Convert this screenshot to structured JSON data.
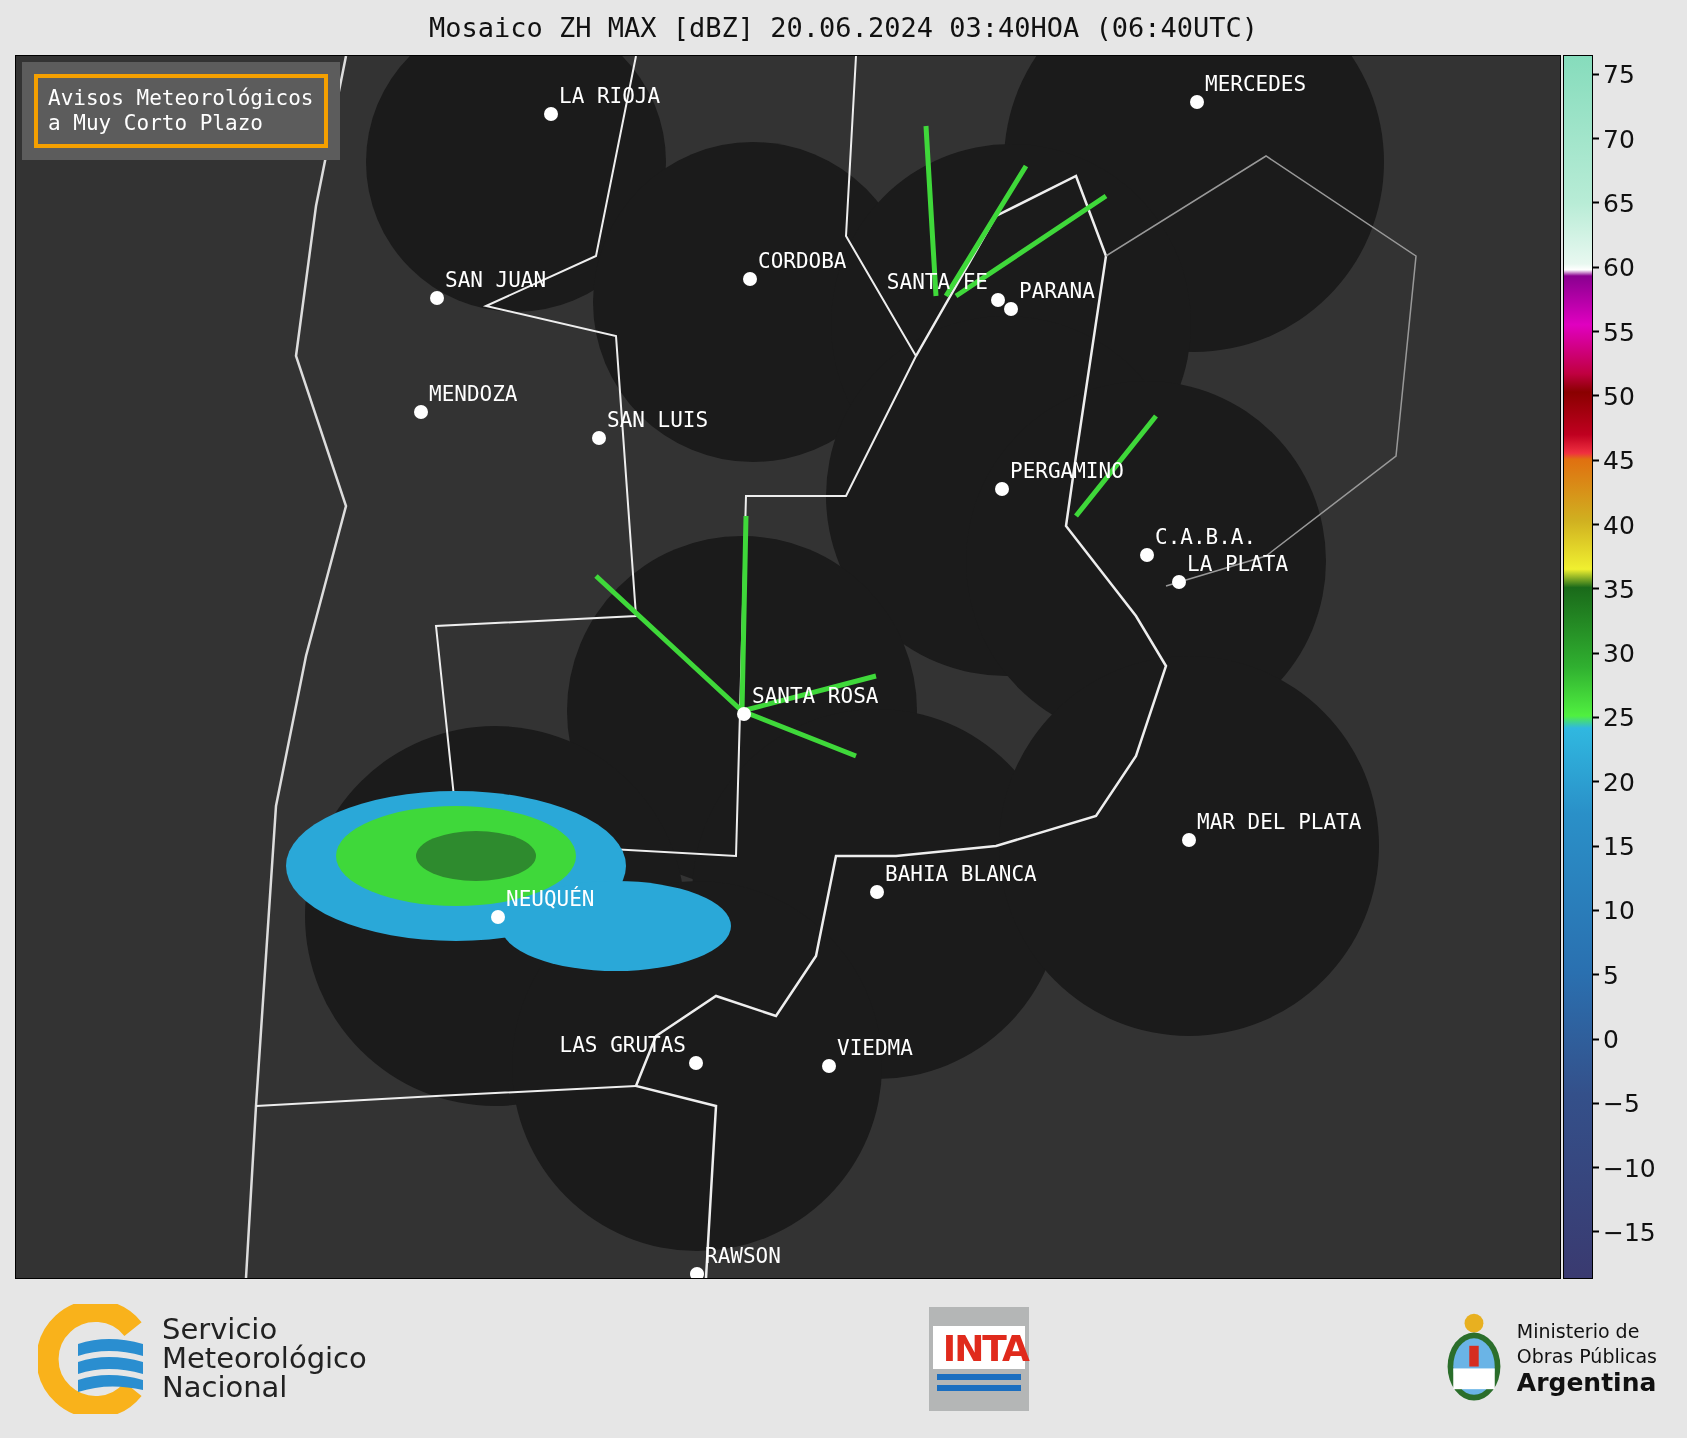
{
  "title": "Mosaico ZH MAX [dBZ] 20.06.2024 03:40HOA (06:40UTC)",
  "notice": {
    "lines": [
      "Avisos Meteorológicos",
      "a Muy Corto Plazo"
    ]
  },
  "cities": [
    {
      "name": "LA RIOJA"
    },
    {
      "name": "MERCEDES"
    },
    {
      "name": "CORDOBA"
    },
    {
      "name": "SAN JUAN"
    },
    {
      "name": "SANTA FE"
    },
    {
      "name": "PARANA"
    },
    {
      "name": "MENDOZA"
    },
    {
      "name": "SAN LUIS"
    },
    {
      "name": "PERGAMINO"
    },
    {
      "name": "C.A.B.A."
    },
    {
      "name": "LA PLATA"
    },
    {
      "name": "SANTA ROSA"
    },
    {
      "name": "MAR DEL PLATA"
    },
    {
      "name": "BAHIA BLANCA"
    },
    {
      "name": "NEUQUÉN"
    },
    {
      "name": "LAS GRUTAS"
    },
    {
      "name": "VIEDMA"
    },
    {
      "name": "RAWSON"
    }
  ],
  "colorbar": {
    "ticks": [
      "75",
      "70",
      "65",
      "60",
      "55",
      "50",
      "45",
      "40",
      "35",
      "30",
      "25",
      "20",
      "15",
      "10",
      "5",
      "0",
      "−5",
      "−10",
      "−15"
    ]
  },
  "footer": {
    "smn_lines": [
      "Servicio",
      "Meteorológico",
      "Nacional"
    ],
    "inta": "INTA",
    "ministry_lines": [
      "Ministerio de",
      "Obras Públicas",
      "Argentina"
    ]
  }
}
